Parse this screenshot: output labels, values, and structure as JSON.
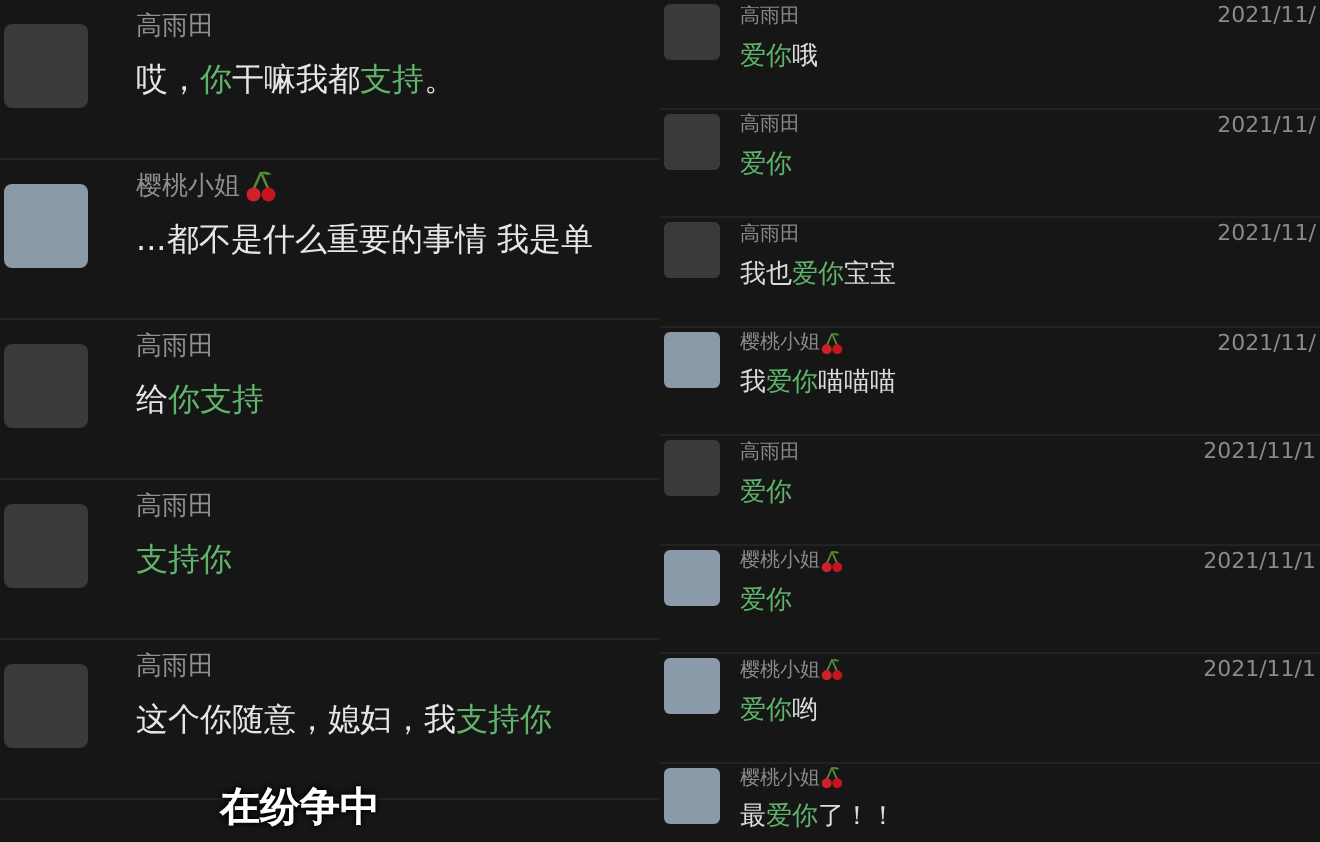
{
  "left_panel": {
    "messages": [
      {
        "sender": "高雨田",
        "avatar_light": false,
        "cherry": false,
        "segments": [
          {
            "text": "哎，",
            "highlight": false
          },
          {
            "text": "你",
            "highlight": true
          },
          {
            "text": "干嘛我都",
            "highlight": false
          },
          {
            "text": "支持",
            "highlight": true
          },
          {
            "text": "。",
            "highlight": false
          }
        ]
      },
      {
        "sender": "樱桃小姐",
        "avatar_light": true,
        "cherry": true,
        "segments": [
          {
            "text": "...都不是什么重要的事情 我是单",
            "highlight": false
          }
        ]
      },
      {
        "sender": "高雨田",
        "avatar_light": false,
        "cherry": false,
        "segments": [
          {
            "text": "给",
            "highlight": false
          },
          {
            "text": "你支持",
            "highlight": true
          }
        ]
      },
      {
        "sender": "高雨田",
        "avatar_light": false,
        "cherry": false,
        "segments": [
          {
            "text": "支持你",
            "highlight": true
          }
        ]
      },
      {
        "sender": "高雨田",
        "avatar_light": false,
        "cherry": false,
        "segments": [
          {
            "text": "这个你随意，媳妇，我",
            "highlight": false
          },
          {
            "text": "支持你",
            "highlight": true
          }
        ]
      }
    ],
    "subtitle": "在纷争中"
  },
  "right_panel": {
    "messages": [
      {
        "sender": "高雨田",
        "avatar_light": false,
        "cherry": false,
        "date": "2021/11/",
        "segments": [
          {
            "text": "爱你",
            "highlight": true
          },
          {
            "text": "哦",
            "highlight": false
          }
        ]
      },
      {
        "sender": "高雨田",
        "avatar_light": false,
        "cherry": false,
        "date": "2021/11/",
        "segments": [
          {
            "text": "爱你",
            "highlight": true
          }
        ]
      },
      {
        "sender": "高雨田",
        "avatar_light": false,
        "cherry": false,
        "date": "2021/11/",
        "segments": [
          {
            "text": "我也",
            "highlight": false
          },
          {
            "text": "爱你",
            "highlight": true
          },
          {
            "text": "宝宝",
            "highlight": false
          }
        ]
      },
      {
        "sender": "樱桃小姐",
        "avatar_light": true,
        "cherry": true,
        "date": "2021/11/",
        "segments": [
          {
            "text": "我",
            "highlight": false
          },
          {
            "text": "爱你",
            "highlight": true
          },
          {
            "text": "喵喵喵",
            "highlight": false
          }
        ]
      },
      {
        "sender": "高雨田",
        "avatar_light": false,
        "cherry": false,
        "date": "2021/11/1",
        "segments": [
          {
            "text": "爱你",
            "highlight": true
          }
        ]
      },
      {
        "sender": "樱桃小姐",
        "avatar_light": true,
        "cherry": true,
        "date": "2021/11/1",
        "segments": [
          {
            "text": "爱你",
            "highlight": true
          }
        ]
      },
      {
        "sender": "樱桃小姐",
        "avatar_light": true,
        "cherry": true,
        "date": "2021/11/1",
        "segments": [
          {
            "text": "爱你",
            "highlight": true
          },
          {
            "text": "哟",
            "highlight": false
          }
        ]
      },
      {
        "sender": "樱桃小姐",
        "avatar_light": true,
        "cherry": true,
        "segments": [
          {
            "text": "最",
            "highlight": false
          },
          {
            "text": "爱你",
            "highlight": true
          },
          {
            "text": "了！！",
            "highlight": false
          }
        ]
      }
    ]
  }
}
